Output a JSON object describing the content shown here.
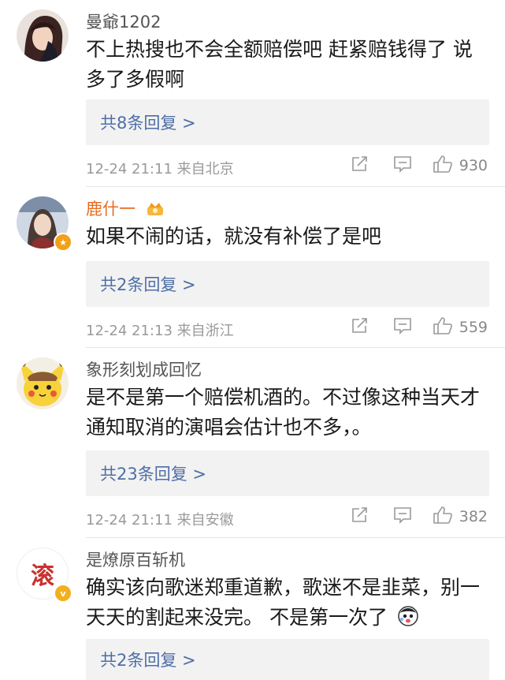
{
  "comments": [
    {
      "username": "曼爺1202",
      "text": "不上热搜也不会全额赔偿吧 赶紧赔钱得了 说多了多假啊",
      "reply_label": "共8条回复 >",
      "time": "12-24 21:11",
      "location": "来自北京",
      "likes": "930"
    },
    {
      "username": "鹿什一",
      "text": "如果不闹的话，就没有补偿了是吧",
      "reply_label": "共2条回复 >",
      "time": "12-24 21:13",
      "location": "来自浙江",
      "likes": "559"
    },
    {
      "username": "象形刻划成回忆",
      "text": "是不是第一个赔偿机酒的。不过像这种当天才通知取消的演唱会估计也不多，。",
      "reply_label": "共23条回复 >",
      "time": "12-24 21:11",
      "location": "来自安徽",
      "likes": "382"
    },
    {
      "username": "是燎原百斩机",
      "avatar_char": "滚",
      "text": "确实该向歌迷郑重道歉，歌迷不是韭菜，别一天天的割起来没完。 不是第一次了",
      "reply_label": "共2条回复 >"
    }
  ],
  "colors": {
    "link_blue": "#4e6ea6",
    "vip_orange": "#e86b1f",
    "meta_gray": "#9a9a9a"
  },
  "icons": [
    "share-icon",
    "comment-icon",
    "like-icon",
    "crown-icon",
    "verified-badge-icon",
    "emoji-icon"
  ]
}
